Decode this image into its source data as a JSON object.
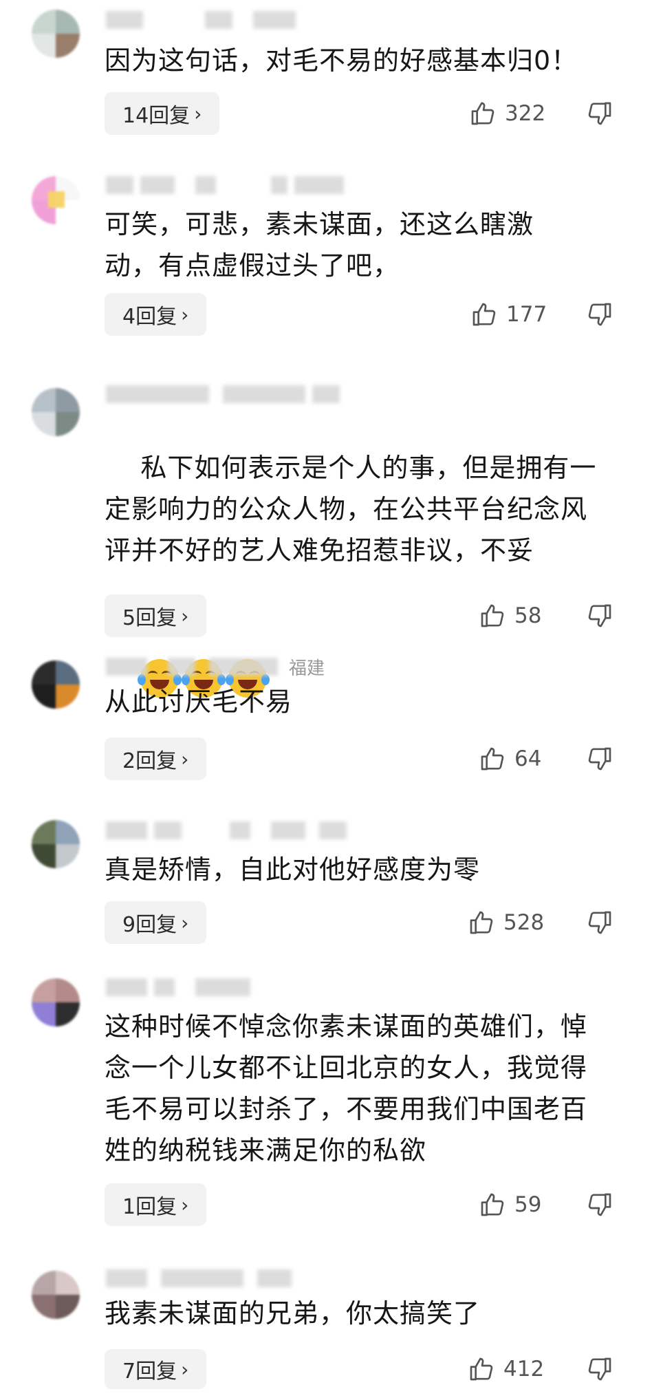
{
  "comments": [
    {
      "meta_location": "",
      "text": "因为这句话，对毛不易的好感基本归0！",
      "replies_label": "14回复",
      "likes": "322",
      "avatar_colors": [
        "#c9d6d0",
        "#a7b9b3",
        "#9a7d6a",
        "#e2e6e4"
      ]
    },
    {
      "meta_location": "",
      "text": "可笑，可悲，素未谋面，还这么瞎激动，有点虚假过头了吧，",
      "replies_label": "4回复",
      "likes": "177",
      "avatar_colors": [
        "#f3a8d8",
        "#f6d36b",
        "#f7f7f7",
        "#f0a0d6"
      ]
    },
    {
      "meta_location": "",
      "text": "私下如何表示是个人的事，但是拥有一定影响力的公众人物，在公共平台纪念风评并不好的艺人难免招惹非议，不妥",
      "replies_label": "5回复",
      "likes": "58",
      "avatar_colors": [
        "#b7c1c9",
        "#8f9ba3",
        "#d9dde0",
        "#7d8b86"
      ]
    },
    {
      "meta_location": "福建",
      "text": "从此讨厌毛不易",
      "replies_label": "2回复",
      "likes": "64",
      "avatar_colors": [
        "#2c2c2c",
        "#5a6d80",
        "#d98a2b",
        "#1e1e1e"
      ]
    },
    {
      "meta_location": "",
      "text": "真是矫情，自此对他好感度为零",
      "replies_label": "9回复",
      "likes": "528",
      "avatar_colors": [
        "#6c7a5a",
        "#8fa2b8",
        "#3f4a34",
        "#c4c9cc"
      ]
    },
    {
      "meta_location": "",
      "text": "这种时候不悼念你素未谋面的英雄们，悼念一个儿女都不让回北京的女人，我觉得毛不易可以封杀了，不要用我们中国老百姓的纳税钱来满足你的私欲",
      "replies_label": "1回复",
      "likes": "59",
      "avatar_colors": [
        "#8f7fd6",
        "#c6a0a0",
        "#2d2d2d",
        "#b48a8a"
      ]
    },
    {
      "meta_location": "",
      "text": "我素未谋面的兄弟，你太搞笑了",
      "replies_label": "7回复",
      "likes": "412",
      "avatar_colors": [
        "#b8a6a6",
        "#8a7070",
        "#d8c8c8",
        "#6d5a5a"
      ]
    }
  ],
  "icons": {
    "like": "thumb-up-icon",
    "dislike": "thumb-down-icon",
    "chevron": "chevron-right-icon"
  },
  "colors": {
    "reply_bg": "#f2f2f2",
    "text": "#161616",
    "muted": "#555555"
  }
}
